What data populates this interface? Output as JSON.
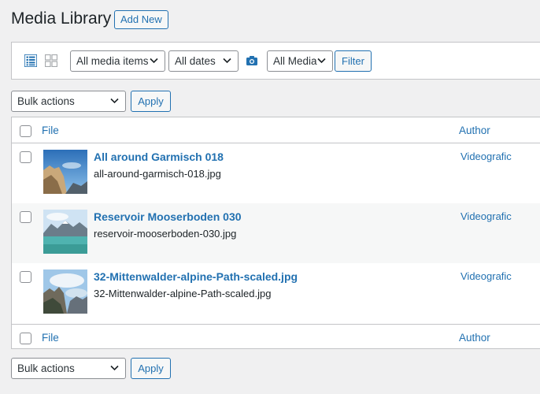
{
  "header": {
    "title": "Media Library",
    "add_new_label": "Add New"
  },
  "filters": {
    "media_type": "All media items",
    "dates": "All dates",
    "media_category": "All Media",
    "filter_label": "Filter"
  },
  "bulk_top": {
    "select": "Bulk actions",
    "apply_label": "Apply"
  },
  "bulk_bottom": {
    "select": "Bulk actions",
    "apply_label": "Apply"
  },
  "table": {
    "columns": {
      "file": "File",
      "author": "Author"
    },
    "rows": [
      {
        "title": "All around Garmisch 018",
        "filename": "all-around-garmisch-018.jpg",
        "author": "Videografic"
      },
      {
        "title": "Reservoir Mooserboden 030",
        "filename": "reservoir-mooserboden-030.jpg",
        "author": "Videografic"
      },
      {
        "title": "32-Mittenwalder-alpine-Path-scaled.jpg",
        "filename": "32-Mittenwalder-alpine-Path-scaled.jpg",
        "author": "Videografic"
      }
    ]
  },
  "colors": {
    "accent": "#2271b1",
    "text": "#1d2327",
    "background": "#f0f0f1"
  }
}
